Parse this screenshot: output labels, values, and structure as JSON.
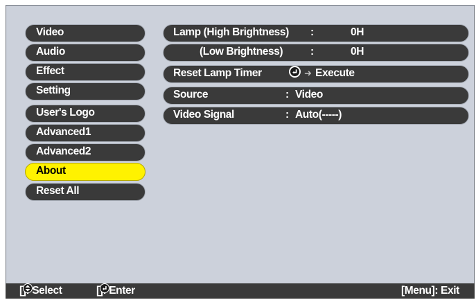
{
  "sidebar": {
    "items": [
      {
        "label": "Video"
      },
      {
        "label": "Audio"
      },
      {
        "label": "Effect"
      },
      {
        "label": "Setting"
      },
      {
        "label": "User's Logo"
      },
      {
        "label": "Advanced1"
      },
      {
        "label": "Advanced2"
      },
      {
        "label": "About",
        "active": true
      },
      {
        "label": "Reset All"
      }
    ]
  },
  "info": {
    "lamp_high": {
      "label": "Lamp (High Brightness)",
      "colon": ":",
      "value": "0H"
    },
    "lamp_low": {
      "label": "(Low Brightness)",
      "colon": ":",
      "value": "0H"
    },
    "reset_lamp": {
      "label": "Reset Lamp Timer",
      "icon": "enter-icon",
      "arrow": "➜",
      "action": "Execute"
    },
    "source": {
      "label": "Source",
      "colon": ":",
      "value": "Video"
    },
    "video_signal": {
      "label": "Video Signal",
      "colon": ":",
      "value": "Auto(-----)"
    }
  },
  "footer": {
    "select_open": "[",
    "select_text": "]: Select",
    "enter_open": "[",
    "enter_text": "]: Enter",
    "exit": "[Menu]: Exit",
    "icons": [
      "updown-arrow-icon",
      "enter-icon"
    ]
  },
  "colors": {
    "panel_bg": "#ccd1db",
    "pill_bg": "#3a3a3a",
    "active_bg": "#fff200",
    "text": "#ffffff"
  }
}
